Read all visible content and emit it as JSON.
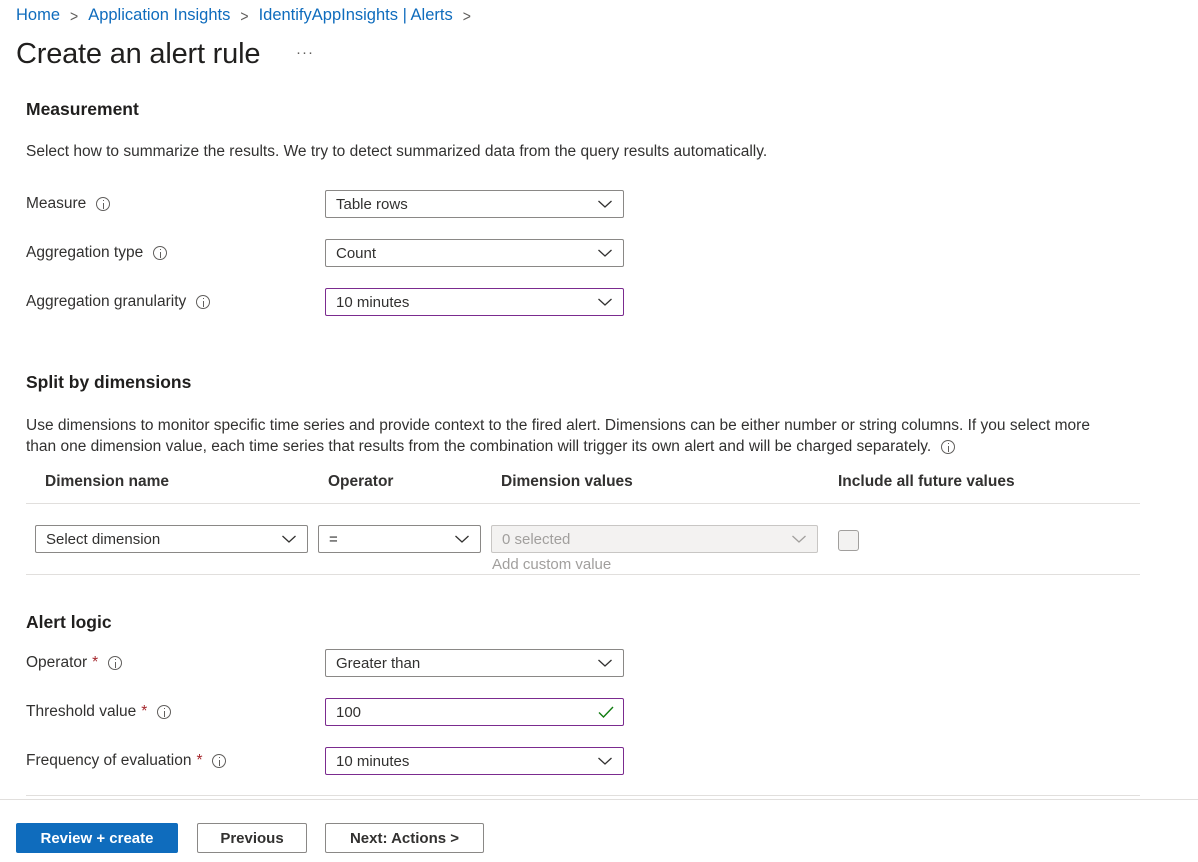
{
  "breadcrumb": {
    "items": [
      "Home",
      "Application Insights",
      "IdentifyAppInsights | Alerts"
    ],
    "separator": ">"
  },
  "page": {
    "title": "Create an alert rule",
    "more": "···"
  },
  "measurement": {
    "heading": "Measurement",
    "description": "Select how to summarize the results. We try to detect summarized data from the query results automatically.",
    "fields": [
      {
        "label": "Measure",
        "value": "Table rows"
      },
      {
        "label": "Aggregation type",
        "value": "Count"
      },
      {
        "label": "Aggregation granularity",
        "value": "10 minutes"
      }
    ]
  },
  "split": {
    "heading": "Split by dimensions",
    "description_line1": "Use dimensions to monitor specific time series and provide context to the fired alert. Dimensions can be either number or string columns. If you select more",
    "description_line2": "than one dimension value, each time series that results from the combination will trigger its own alert and will be charged separately.",
    "columns": [
      "Dimension name",
      "Operator",
      "Dimension values",
      "Include all future values"
    ],
    "row": {
      "dimension_placeholder": "Select dimension",
      "operator": "=",
      "values": "0 selected",
      "custom_value": "Add custom value",
      "include_future": false
    }
  },
  "alert_logic": {
    "heading": "Alert logic",
    "operator": {
      "label": "Operator",
      "required": "*",
      "value": "Greater than"
    },
    "threshold": {
      "label": "Threshold value",
      "required": "*",
      "value": "100"
    },
    "frequency": {
      "label": "Frequency of evaluation",
      "required": "*",
      "value": "10 minutes"
    }
  },
  "footer": {
    "review_create": "Review + create",
    "previous": "Previous",
    "next": "Next: Actions >"
  },
  "colors": {
    "accent": "#0f6cbd",
    "focus_border": "#7b2b8f",
    "valid_check": "#107c10",
    "required": "#a4262c"
  }
}
